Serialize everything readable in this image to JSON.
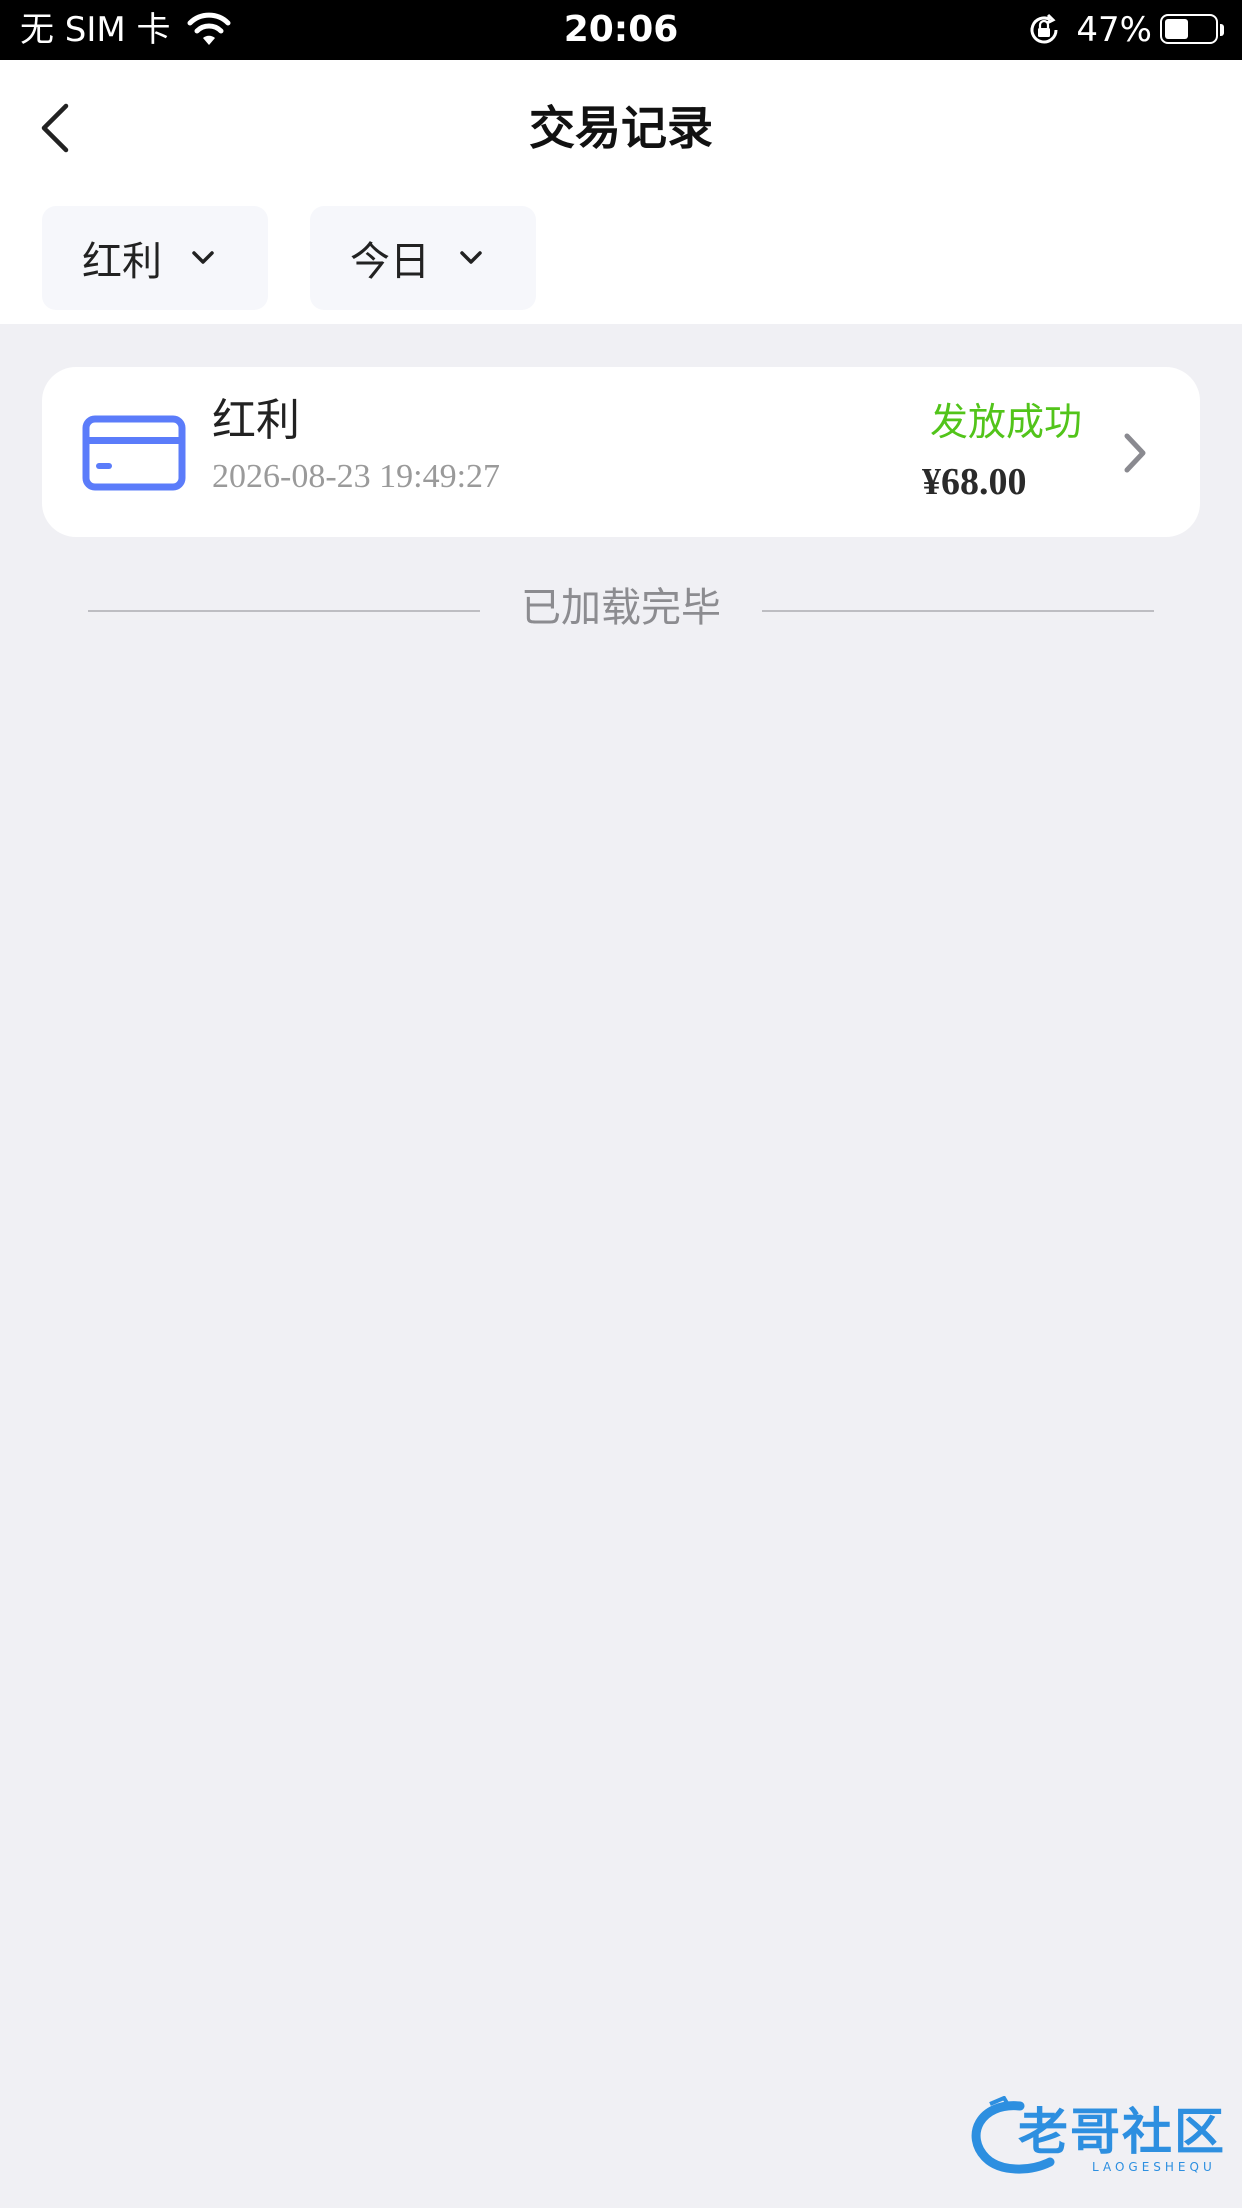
{
  "status_bar": {
    "carrier": "无 SIM 卡",
    "time": "20:06",
    "battery_percent": "47%",
    "battery_level": 0.47
  },
  "header": {
    "title": "交易记录"
  },
  "filters": {
    "type_label": "红利",
    "date_label": "今日"
  },
  "records": [
    {
      "name": "红利",
      "datetime": "2026-08-23 19:49:27",
      "status": "发放成功",
      "amount": "¥68.00",
      "icon": "card-icon"
    }
  ],
  "list_end_text": "已加载完毕",
  "watermark": {
    "text": "老哥社区",
    "subtext": "LAOGESHEQU"
  },
  "colors": {
    "status_success": "#52c41a",
    "icon_blue": "#5b7cfa",
    "background": "#f0f0f4"
  }
}
